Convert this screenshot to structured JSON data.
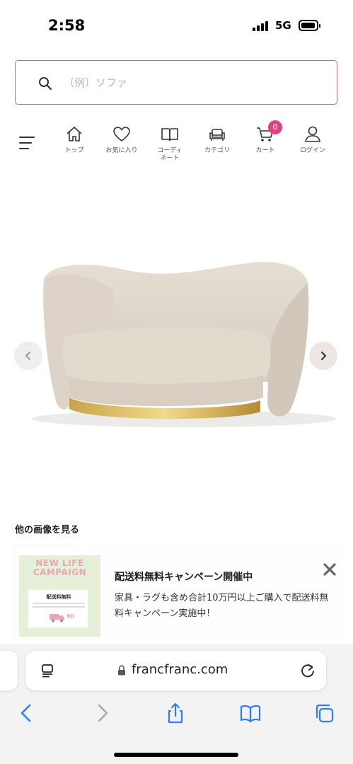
{
  "status_bar": {
    "time": "2:58",
    "network": "5G",
    "icons": [
      "signal-icon",
      "battery-icon"
    ]
  },
  "search": {
    "placeholder": "（例）ソファ",
    "icon": "search-icon"
  },
  "nav": {
    "menu_icon": "hamburger-icon",
    "items": [
      {
        "label": "トップ",
        "icon": "home-icon"
      },
      {
        "label": "お気に入り",
        "icon": "heart-icon"
      },
      {
        "label": "コーディ\nネート",
        "icon": "book-icon"
      },
      {
        "label": "カテゴリ",
        "icon": "sofa-icon"
      },
      {
        "label": "カート",
        "icon": "cart-icon",
        "badge": "0"
      },
      {
        "label": "ログイン",
        "icon": "user-icon"
      }
    ],
    "accent_color": "#e0427b"
  },
  "product": {
    "image": "two-seat-sofa-beige-gold-base",
    "prev_icon": "chevron-left-icon",
    "next_icon": "chevron-right-icon"
  },
  "gallery": {
    "title": "他の画像を見る"
  },
  "campaign": {
    "thumb_title": "NEW LIFE\nCAMPAIGN",
    "thumb_card_title": "配送料無料",
    "thumb_yen": "¥0",
    "title": "配送料無料キャンペーン開催中",
    "body": "家具・ラグも含め合計10万円以上ご購入で配送料無料キャンペーン実施中！",
    "close_icon": "close-icon"
  },
  "browser": {
    "url": "francfranc.com",
    "icons": [
      "reader-icon",
      "lock-icon",
      "reload-icon"
    ],
    "toolbar": [
      "back-icon",
      "forward-icon",
      "share-icon",
      "bookmarks-icon",
      "tabs-icon"
    ],
    "accent_color": "#2f7cf6"
  }
}
